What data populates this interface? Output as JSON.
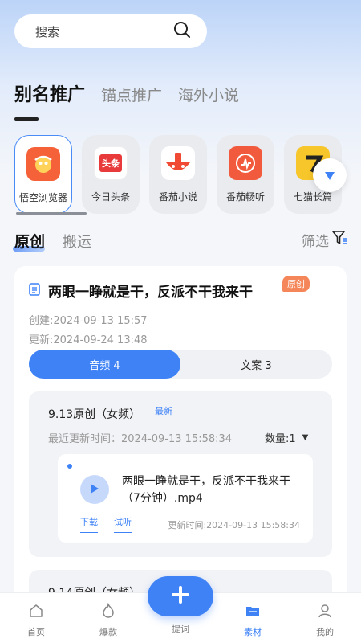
{
  "search": {
    "placeholder": "搜索",
    "icon": "search-icon"
  },
  "top_tabs": [
    {
      "label": "别名推广",
      "active": true
    },
    {
      "label": "锚点推广",
      "active": false
    },
    {
      "label": "海外小说",
      "active": false
    }
  ],
  "apps": [
    {
      "label": "悟空浏览器",
      "selected": true,
      "icon": "wukong-browser-icon",
      "color": "#f5623a"
    },
    {
      "label": "今日头条",
      "selected": false,
      "icon": "toutiao-icon",
      "icon_text": "头条",
      "color": "#e83a3a"
    },
    {
      "label": "番茄小说",
      "selected": false,
      "icon": "tomato-novel-icon",
      "color": "#f04a35"
    },
    {
      "label": "番茄畅听",
      "selected": false,
      "icon": "tomato-listen-icon",
      "color": "#f15a3c"
    },
    {
      "label": "七猫长篇",
      "selected": false,
      "icon": "qimao-icon",
      "color": "#f7c62a"
    }
  ],
  "sub_tabs": [
    {
      "label": "原创",
      "active": true
    },
    {
      "label": "搬运",
      "active": false
    }
  ],
  "filter_label": "筛选",
  "card": {
    "title": "两眼一睁就是干，反派不干我来干",
    "badge": "原创",
    "created": "创建:2024-09-13 15:57",
    "updated": "更新:2024-09-24 13:48",
    "seg_audio": "音频 4",
    "seg_text": "文案 3",
    "group": {
      "name": "9.13原创（女频）",
      "new_tag": "最新",
      "last_update": "最近更新时间：2024-09-13 15:58:34",
      "quantity": "数量:1",
      "file": {
        "name": "两眼一睁就是干，反派不干我来干（7分钟）.mp4",
        "download": "下载",
        "preview": "试听",
        "time": "更新时间:2024-09-13 15:58:34"
      }
    },
    "group2_name": "9.14原创（女频）"
  },
  "tabbar": [
    {
      "label": "首页",
      "icon": "home-icon",
      "active": false
    },
    {
      "label": "爆款",
      "icon": "fire-icon",
      "active": false
    },
    {
      "label": "提词",
      "icon": "add-icon",
      "active": false
    },
    {
      "label": "素材",
      "icon": "folder-icon",
      "active": true
    },
    {
      "label": "我的",
      "icon": "user-icon",
      "active": false
    }
  ],
  "colors": {
    "accent": "#3e82f6",
    "badge": "#f4865a"
  }
}
